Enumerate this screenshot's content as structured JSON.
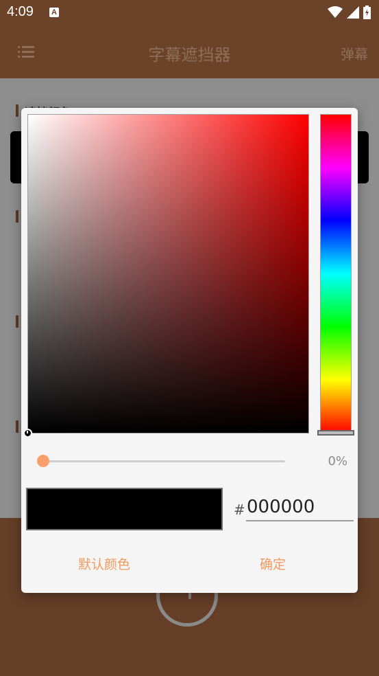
{
  "status_bar": {
    "time": "4:09",
    "notification_glyph": "A"
  },
  "app_bar": {
    "title": "字幕遮挡器",
    "action": "弹幕"
  },
  "background": {
    "section_label": "遮挡颜色"
  },
  "color_picker": {
    "hue": "#ff0000",
    "alpha_label": "0%",
    "alpha_percent": 0,
    "hash": "#",
    "hex_value": "000000",
    "selected_color": "#000000"
  },
  "dialog_buttons": {
    "default_label": "默认颜色",
    "ok_label": "确定"
  },
  "colors": {
    "accent": "#f19a5f",
    "app_brown": "#6b4329"
  }
}
